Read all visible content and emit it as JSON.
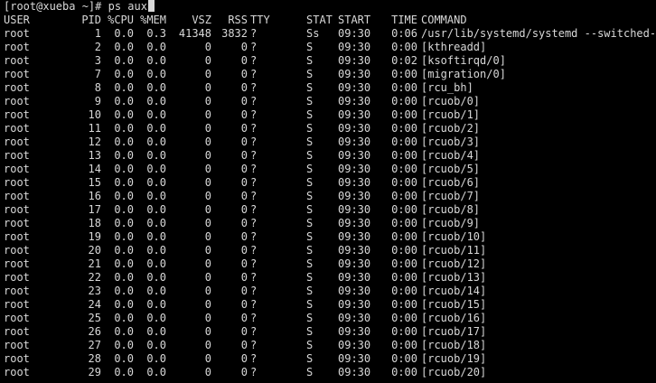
{
  "terminal": {
    "prompt": "[root@xueba ~]#",
    "command": "ps aux",
    "colors": {
      "background": "#000000",
      "foreground": "#d8d8d8",
      "cursor": "#d8d8d8"
    },
    "header": {
      "user": "USER",
      "pid": "PID",
      "cpu": "%CPU",
      "mem": "%MEM",
      "vsz": "VSZ",
      "rss": "RSS",
      "tty": "TTY",
      "stat": "STAT",
      "start": "START",
      "time": "TIME",
      "command": "COMMAND"
    },
    "processes": [
      {
        "user": "root",
        "pid": "1",
        "cpu": "0.0",
        "mem": "0.3",
        "vsz": "41348",
        "rss": "3832",
        "tty": "?",
        "stat": "Ss",
        "start": "09:30",
        "time": "0:06",
        "command": "/usr/lib/systemd/systemd --switched-r"
      },
      {
        "user": "root",
        "pid": "2",
        "cpu": "0.0",
        "mem": "0.0",
        "vsz": "0",
        "rss": "0",
        "tty": "?",
        "stat": "S",
        "start": "09:30",
        "time": "0:00",
        "command": "[kthreadd]"
      },
      {
        "user": "root",
        "pid": "3",
        "cpu": "0.0",
        "mem": "0.0",
        "vsz": "0",
        "rss": "0",
        "tty": "?",
        "stat": "S",
        "start": "09:30",
        "time": "0:02",
        "command": "[ksoftirqd/0]"
      },
      {
        "user": "root",
        "pid": "7",
        "cpu": "0.0",
        "mem": "0.0",
        "vsz": "0",
        "rss": "0",
        "tty": "?",
        "stat": "S",
        "start": "09:30",
        "time": "0:00",
        "command": "[migration/0]"
      },
      {
        "user": "root",
        "pid": "8",
        "cpu": "0.0",
        "mem": "0.0",
        "vsz": "0",
        "rss": "0",
        "tty": "?",
        "stat": "S",
        "start": "09:30",
        "time": "0:00",
        "command": "[rcu_bh]"
      },
      {
        "user": "root",
        "pid": "9",
        "cpu": "0.0",
        "mem": "0.0",
        "vsz": "0",
        "rss": "0",
        "tty": "?",
        "stat": "S",
        "start": "09:30",
        "time": "0:00",
        "command": "[rcuob/0]"
      },
      {
        "user": "root",
        "pid": "10",
        "cpu": "0.0",
        "mem": "0.0",
        "vsz": "0",
        "rss": "0",
        "tty": "?",
        "stat": "S",
        "start": "09:30",
        "time": "0:00",
        "command": "[rcuob/1]"
      },
      {
        "user": "root",
        "pid": "11",
        "cpu": "0.0",
        "mem": "0.0",
        "vsz": "0",
        "rss": "0",
        "tty": "?",
        "stat": "S",
        "start": "09:30",
        "time": "0:00",
        "command": "[rcuob/2]"
      },
      {
        "user": "root",
        "pid": "12",
        "cpu": "0.0",
        "mem": "0.0",
        "vsz": "0",
        "rss": "0",
        "tty": "?",
        "stat": "S",
        "start": "09:30",
        "time": "0:00",
        "command": "[rcuob/3]"
      },
      {
        "user": "root",
        "pid": "13",
        "cpu": "0.0",
        "mem": "0.0",
        "vsz": "0",
        "rss": "0",
        "tty": "?",
        "stat": "S",
        "start": "09:30",
        "time": "0:00",
        "command": "[rcuob/4]"
      },
      {
        "user": "root",
        "pid": "14",
        "cpu": "0.0",
        "mem": "0.0",
        "vsz": "0",
        "rss": "0",
        "tty": "?",
        "stat": "S",
        "start": "09:30",
        "time": "0:00",
        "command": "[rcuob/5]"
      },
      {
        "user": "root",
        "pid": "15",
        "cpu": "0.0",
        "mem": "0.0",
        "vsz": "0",
        "rss": "0",
        "tty": "?",
        "stat": "S",
        "start": "09:30",
        "time": "0:00",
        "command": "[rcuob/6]"
      },
      {
        "user": "root",
        "pid": "16",
        "cpu": "0.0",
        "mem": "0.0",
        "vsz": "0",
        "rss": "0",
        "tty": "?",
        "stat": "S",
        "start": "09:30",
        "time": "0:00",
        "command": "[rcuob/7]"
      },
      {
        "user": "root",
        "pid": "17",
        "cpu": "0.0",
        "mem": "0.0",
        "vsz": "0",
        "rss": "0",
        "tty": "?",
        "stat": "S",
        "start": "09:30",
        "time": "0:00",
        "command": "[rcuob/8]"
      },
      {
        "user": "root",
        "pid": "18",
        "cpu": "0.0",
        "mem": "0.0",
        "vsz": "0",
        "rss": "0",
        "tty": "?",
        "stat": "S",
        "start": "09:30",
        "time": "0:00",
        "command": "[rcuob/9]"
      },
      {
        "user": "root",
        "pid": "19",
        "cpu": "0.0",
        "mem": "0.0",
        "vsz": "0",
        "rss": "0",
        "tty": "?",
        "stat": "S",
        "start": "09:30",
        "time": "0:00",
        "command": "[rcuob/10]"
      },
      {
        "user": "root",
        "pid": "20",
        "cpu": "0.0",
        "mem": "0.0",
        "vsz": "0",
        "rss": "0",
        "tty": "?",
        "stat": "S",
        "start": "09:30",
        "time": "0:00",
        "command": "[rcuob/11]"
      },
      {
        "user": "root",
        "pid": "21",
        "cpu": "0.0",
        "mem": "0.0",
        "vsz": "0",
        "rss": "0",
        "tty": "?",
        "stat": "S",
        "start": "09:30",
        "time": "0:00",
        "command": "[rcuob/12]"
      },
      {
        "user": "root",
        "pid": "22",
        "cpu": "0.0",
        "mem": "0.0",
        "vsz": "0",
        "rss": "0",
        "tty": "?",
        "stat": "S",
        "start": "09:30",
        "time": "0:00",
        "command": "[rcuob/13]"
      },
      {
        "user": "root",
        "pid": "23",
        "cpu": "0.0",
        "mem": "0.0",
        "vsz": "0",
        "rss": "0",
        "tty": "?",
        "stat": "S",
        "start": "09:30",
        "time": "0:00",
        "command": "[rcuob/14]"
      },
      {
        "user": "root",
        "pid": "24",
        "cpu": "0.0",
        "mem": "0.0",
        "vsz": "0",
        "rss": "0",
        "tty": "?",
        "stat": "S",
        "start": "09:30",
        "time": "0:00",
        "command": "[rcuob/15]"
      },
      {
        "user": "root",
        "pid": "25",
        "cpu": "0.0",
        "mem": "0.0",
        "vsz": "0",
        "rss": "0",
        "tty": "?",
        "stat": "S",
        "start": "09:30",
        "time": "0:00",
        "command": "[rcuob/16]"
      },
      {
        "user": "root",
        "pid": "26",
        "cpu": "0.0",
        "mem": "0.0",
        "vsz": "0",
        "rss": "0",
        "tty": "?",
        "stat": "S",
        "start": "09:30",
        "time": "0:00",
        "command": "[rcuob/17]"
      },
      {
        "user": "root",
        "pid": "27",
        "cpu": "0.0",
        "mem": "0.0",
        "vsz": "0",
        "rss": "0",
        "tty": "?",
        "stat": "S",
        "start": "09:30",
        "time": "0:00",
        "command": "[rcuob/18]"
      },
      {
        "user": "root",
        "pid": "28",
        "cpu": "0.0",
        "mem": "0.0",
        "vsz": "0",
        "rss": "0",
        "tty": "?",
        "stat": "S",
        "start": "09:30",
        "time": "0:00",
        "command": "[rcuob/19]"
      },
      {
        "user": "root",
        "pid": "29",
        "cpu": "0.0",
        "mem": "0.0",
        "vsz": "0",
        "rss": "0",
        "tty": "?",
        "stat": "S",
        "start": "09:30",
        "time": "0:00",
        "command": "[rcuob/20]"
      }
    ]
  }
}
